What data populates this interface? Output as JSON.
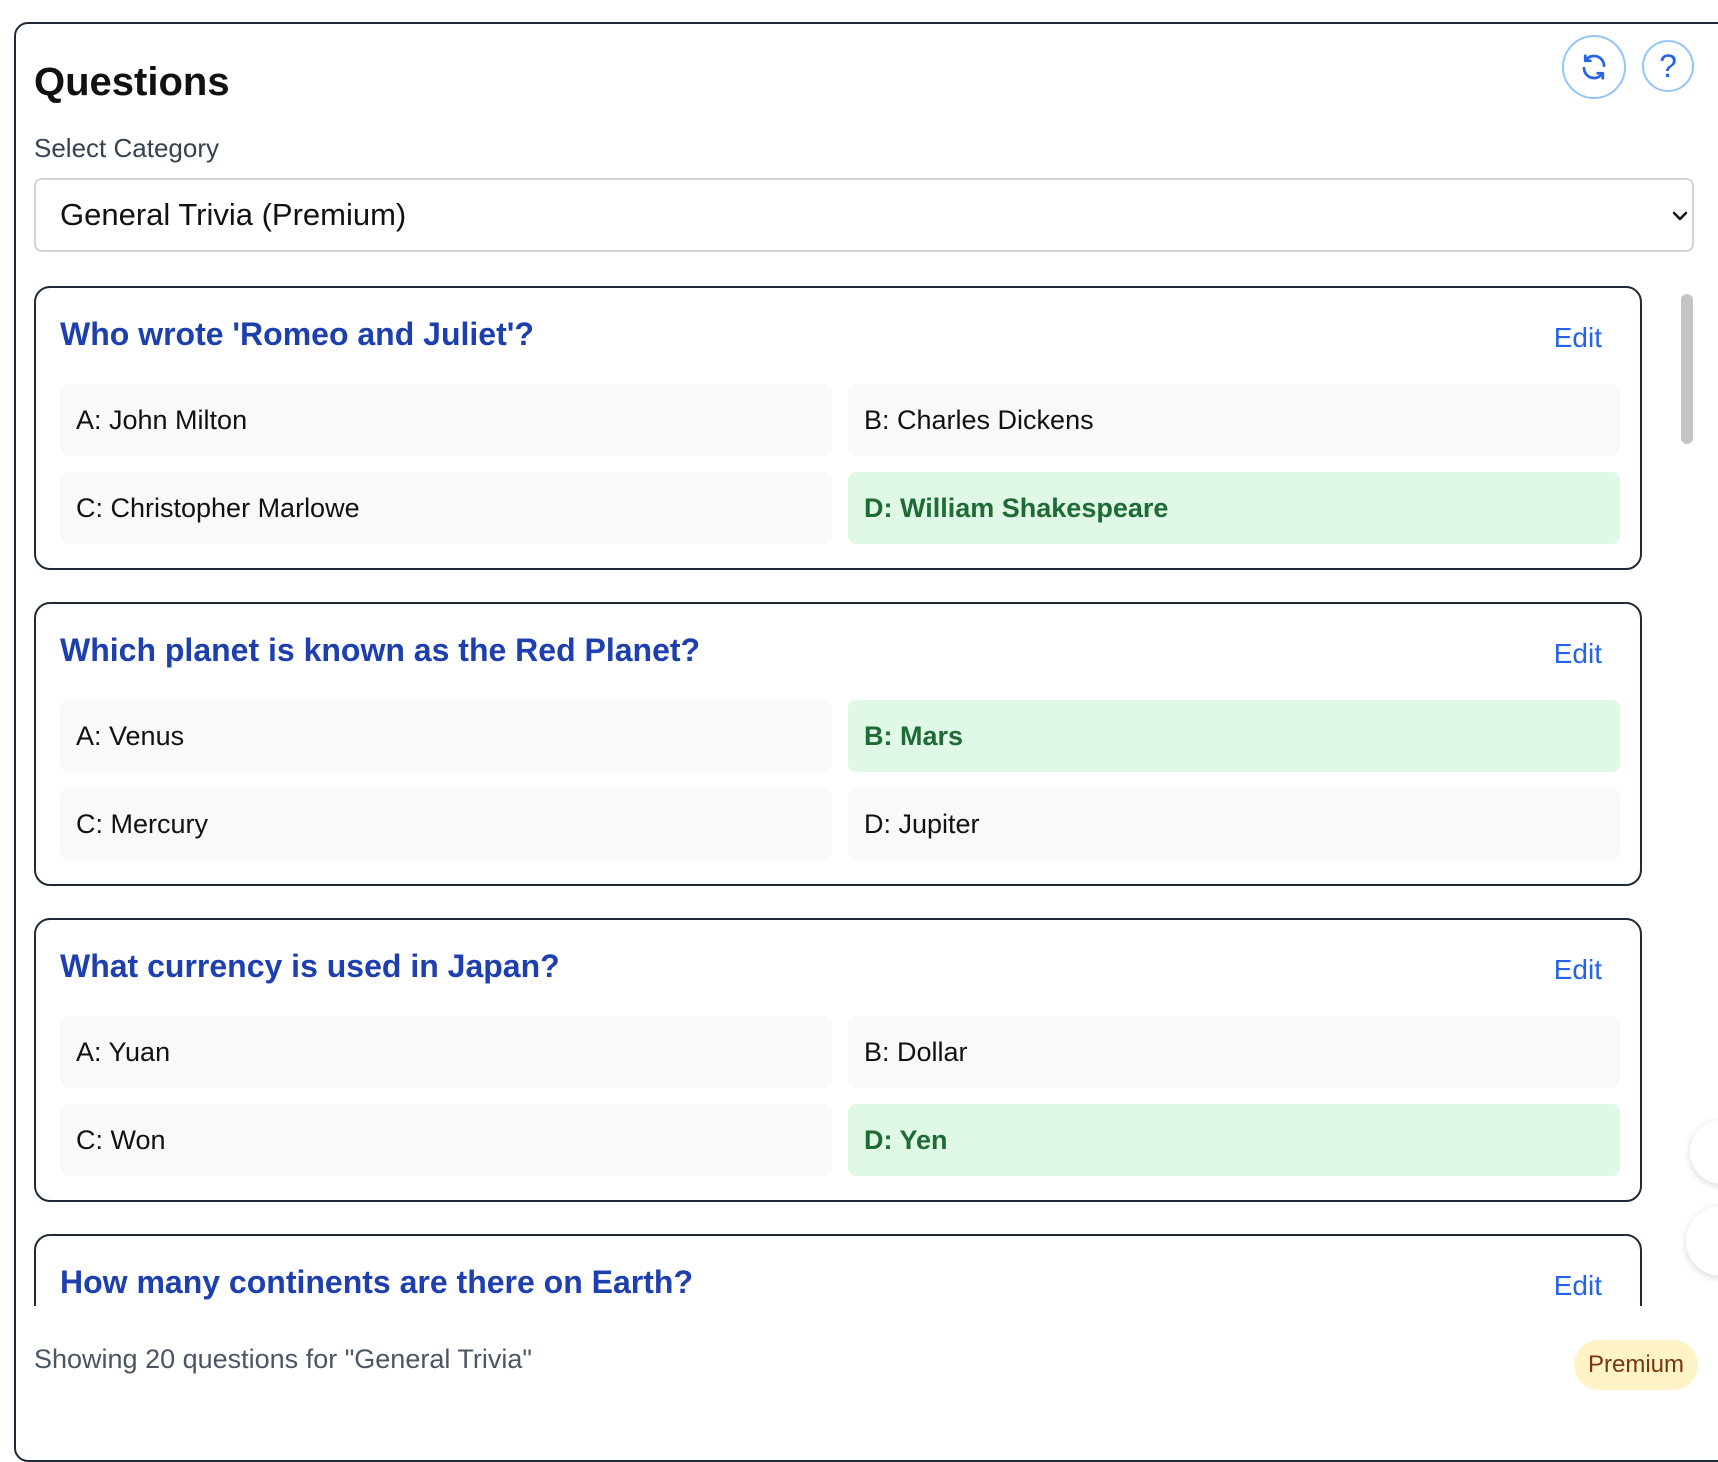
{
  "header": {
    "title": "Questions",
    "refresh_icon": "refresh-icon",
    "help_icon": "help-icon",
    "help_glyph": "?"
  },
  "category": {
    "label": "Select Category",
    "selected": "General Trivia (Premium)"
  },
  "questions": [
    {
      "text": "Who wrote 'Romeo and Juliet'?",
      "edit_label": "Edit",
      "options": [
        "A: John Milton",
        "B: Charles Dickens",
        "C: Christopher Marlowe",
        "D: William Shakespeare"
      ],
      "correct": 3
    },
    {
      "text": "Which planet is known as the Red Planet?",
      "edit_label": "Edit",
      "options": [
        "A: Venus",
        "B: Mars",
        "C: Mercury",
        "D: Jupiter"
      ],
      "correct": 1
    },
    {
      "text": "What currency is used in Japan?",
      "edit_label": "Edit",
      "options": [
        "A: Yuan",
        "B: Dollar",
        "C: Won",
        "D: Yen"
      ],
      "correct": 3
    },
    {
      "text": "How many continents are there on Earth?",
      "edit_label": "Edit",
      "options": [
        "",
        "",
        "",
        ""
      ],
      "correct": -1
    }
  ],
  "footer": {
    "status": "Showing 20 questions for \"General Trivia\"",
    "badge": "Premium"
  },
  "colors": {
    "question": "#1e40af",
    "link": "#2563eb",
    "correct_bg": "#e0f8e6",
    "correct_text": "#1f6b36",
    "badge_bg": "#fef3c7"
  }
}
